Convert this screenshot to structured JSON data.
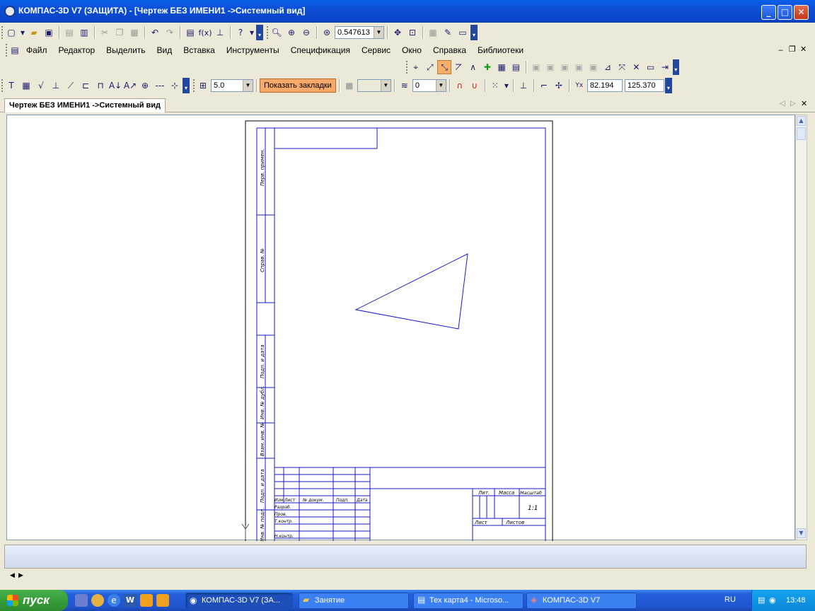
{
  "window": {
    "title": "КОМПАС-3D V7 (ЗАЩИТА) - [Чертеж БЕЗ ИМЕНИ1 ->Системный вид]",
    "accent": "#0a5fe8"
  },
  "toolbar_main": {
    "zoom_value": "0.547613"
  },
  "menu": {
    "items": [
      "Файл",
      "Редактор",
      "Выделить",
      "Вид",
      "Вставка",
      "Инструменты",
      "Спецификация",
      "Сервис",
      "Окно",
      "Справка",
      "Библиотеки"
    ]
  },
  "toolbar_params": {
    "step_value": "5.0",
    "bookmarks_button": "Показать закладки",
    "layer_value": "0",
    "coord_x": "82.194",
    "coord_y": "125.370"
  },
  "tabs": [
    {
      "label": "Чертеж БЕЗ ИМЕНИ1 ->Системный вид",
      "active": true
    }
  ],
  "drawing": {
    "line_color": "#1a1acc",
    "side_labels": [
      "Перв. примен.",
      "Справ. №",
      "Подп. и дата",
      "Инв. № дубл.",
      "Взам. инв. №",
      "Подп. и дата",
      "Инв. № подл."
    ],
    "stamp": {
      "col_headers": [
        "Изм.",
        "Лист",
        "№ докум.",
        "Подп.",
        "Дата"
      ],
      "row_labels": [
        "Разраб.",
        "Пров.",
        "Т.контр.",
        "Н.контр."
      ],
      "lit": "Лит.",
      "mass": "Масса",
      "scale_header": "Масштаб",
      "scale_value": "1:1",
      "sheet": "Лист",
      "sheets": "Листов"
    }
  },
  "taskbar": {
    "start": "пуск",
    "items": [
      {
        "label": "КОМПАС-3D V7 (ЗА...",
        "active": true
      },
      {
        "label": "Занятие",
        "active": false
      },
      {
        "label": "Тех карта4 - Microso...",
        "active": false
      },
      {
        "label": "КОМПАС-3D V7",
        "active": false
      }
    ],
    "lang": "RU",
    "clock": "13:48"
  }
}
